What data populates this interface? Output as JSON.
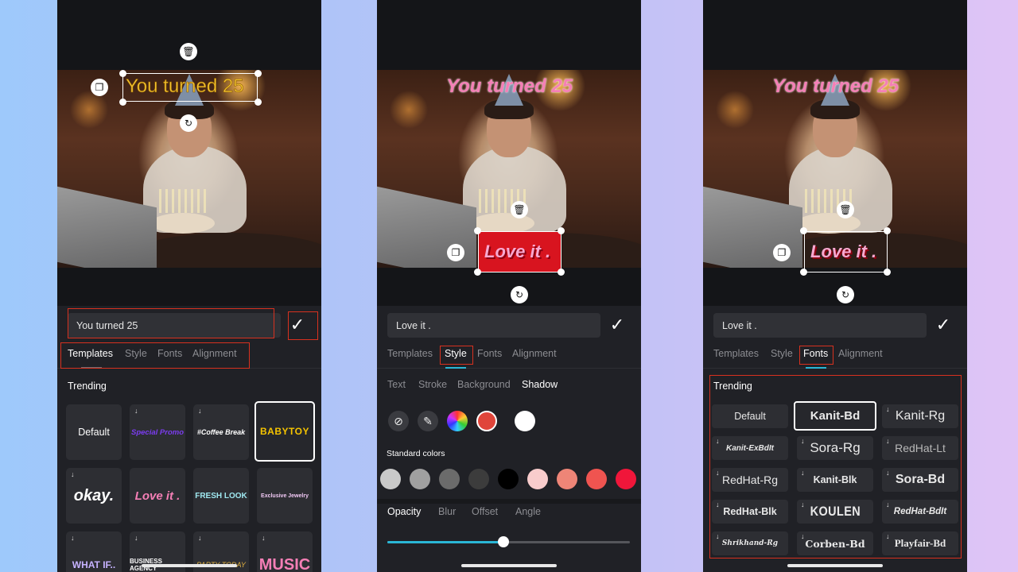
{
  "phone1": {
    "overlay_text": "You turned 25",
    "input_value": "You turned 25",
    "tabs": [
      "Templates",
      "Style",
      "Fonts",
      "Alignment"
    ],
    "section": "Trending",
    "templates": [
      {
        "label": "Default",
        "download": false
      },
      {
        "label": "Special Promo",
        "download": true
      },
      {
        "label": "#Coffee Break",
        "download": true
      },
      {
        "label": "BABYTOY",
        "download": false
      },
      {
        "label": "okay.",
        "download": true
      },
      {
        "label": "Love it .",
        "download": false
      },
      {
        "label": "FRESH LOOK",
        "download": false
      },
      {
        "label": "Exclusive Jewelry",
        "download": false
      },
      {
        "label": "WHAT IF..",
        "download": true
      },
      {
        "label": "BUSINESS AGENCY",
        "download": true
      },
      {
        "label": "PARTY TODAY",
        "download": true
      },
      {
        "label": "MUSIC",
        "download": true
      }
    ]
  },
  "phone2": {
    "overlay_text": "You turned 25",
    "overlay_sticker": "Love it .",
    "input_value": "Love it .",
    "tabs": [
      "Templates",
      "Style",
      "Fonts",
      "Alignment"
    ],
    "subtabs": [
      "Text",
      "Stroke",
      "Background",
      "Shadow"
    ],
    "standard_colors_label": "Standard colors",
    "standard_colors": [
      "#c9c9c9",
      "#a0a0a0",
      "#6b6b6b",
      "#3c3c3c",
      "#000000",
      "#f8cccc",
      "#ee8577",
      "#ef5450",
      "#f0163a"
    ],
    "selected_color": "#e0453a",
    "bottom_tabs": [
      "Opacity",
      "Blur",
      "Offset",
      "Angle"
    ],
    "opacity_value": 0.48
  },
  "phone3": {
    "overlay_text": "You turned 25",
    "overlay_sticker": "Love it .",
    "input_value": "Love it .",
    "tabs": [
      "Templates",
      "Style",
      "Fonts",
      "Alignment"
    ],
    "section": "Trending",
    "fonts": [
      {
        "label": "Default",
        "download": false
      },
      {
        "label": "Kanit-Bd",
        "download": false
      },
      {
        "label": "Kanit-Rg",
        "download": true
      },
      {
        "label": "Kanit-ExBdIt",
        "download": true
      },
      {
        "label": "Sora-Rg",
        "download": true
      },
      {
        "label": "RedHat-Lt",
        "download": true
      },
      {
        "label": "RedHat-Rg",
        "download": true
      },
      {
        "label": "Kanit-Blk",
        "download": true
      },
      {
        "label": "Sora-Bd",
        "download": true
      },
      {
        "label": "RedHat-Blk",
        "download": true
      },
      {
        "label": "KOULEN",
        "download": true
      },
      {
        "label": "RedHat-BdIt",
        "download": true
      },
      {
        "label": "Shrikhand-Rg",
        "download": true
      },
      {
        "label": "Corben-Bd",
        "download": true
      },
      {
        "label": "Playfair-Bd",
        "download": true
      }
    ]
  },
  "icons": {
    "delete": "trash-icon",
    "duplicate": "copy-icon",
    "rotate": "rotate-icon",
    "confirm": "checkmark-icon",
    "download": "download-arrow-icon"
  },
  "colors": {
    "accent": "#2ab7d6",
    "highlight_red": "#d8311f",
    "overlay_yellow": "#f4c430",
    "overlay_pink": "#f57fb6"
  }
}
